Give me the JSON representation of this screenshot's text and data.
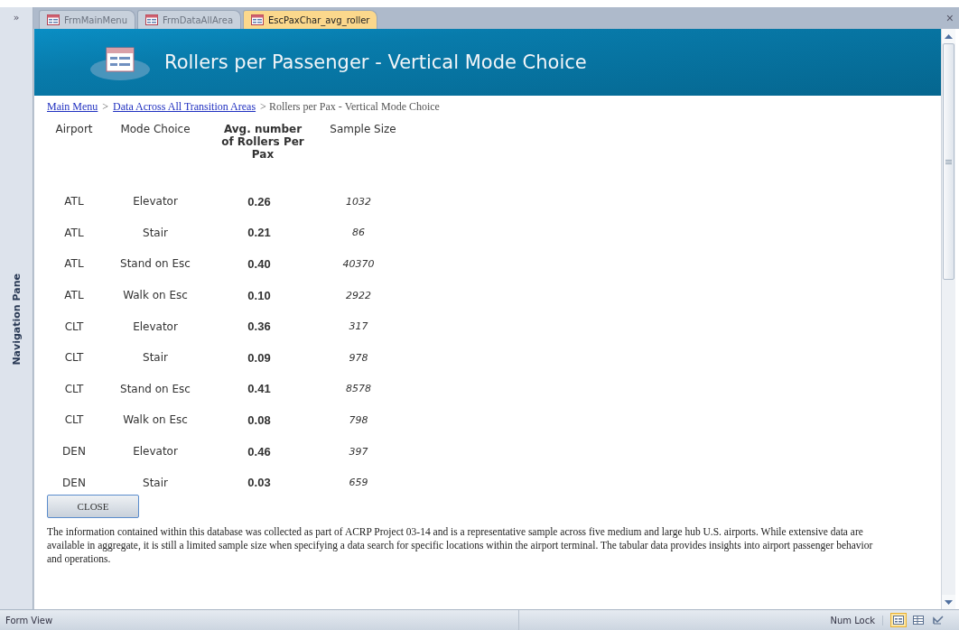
{
  "nav_toggle": "»",
  "nav_pane": {
    "label": "Navigation Pane"
  },
  "tabs": [
    {
      "label": "FrmMainMenu",
      "selected": false
    },
    {
      "label": "FrmDataAllArea",
      "selected": false
    },
    {
      "label": "EscPaxChar_avg_roller",
      "selected": true
    }
  ],
  "close_tab": "×",
  "header": {
    "title": "Rollers per Passenger - Vertical Mode Choice"
  },
  "breadcrumb": [
    {
      "label": "Main Menu",
      "kind": "link"
    },
    {
      "label": ">",
      "kind": "separator"
    },
    {
      "label": "Data Across All Transition Areas",
      "kind": "link"
    },
    {
      "label": "> Rollers per Pax - Vertical Mode Choice",
      "kind": "current"
    }
  ],
  "table": {
    "columns": [
      "Airport",
      "Mode Choice",
      "Avg. number of Rollers Per Pax",
      "Sample Size"
    ],
    "rows": [
      [
        "ATL",
        "Elevator",
        "0.26",
        "1032"
      ],
      [
        "ATL",
        "Stair",
        "0.21",
        "86"
      ],
      [
        "ATL",
        "Stand on Esc",
        "0.40",
        "40370"
      ],
      [
        "ATL",
        "Walk on Esc",
        "0.10",
        "2922"
      ],
      [
        "CLT",
        "Elevator",
        "0.36",
        "317"
      ],
      [
        "CLT",
        "Stair",
        "0.09",
        "978"
      ],
      [
        "CLT",
        "Stand on Esc",
        "0.41",
        "8578"
      ],
      [
        "CLT",
        "Walk on Esc",
        "0.08",
        "798"
      ],
      [
        "DEN",
        "Elevator",
        "0.46",
        "397"
      ],
      [
        "DEN",
        "Stair",
        "0.03",
        "659"
      ]
    ]
  },
  "close_button": "CLOSE",
  "note": "The information contained within this database was collected as part of ACRP Project 03-14 and is a representative sample across five medium and large hub U.S. airports. While extensive data are available in aggregate, it is still a limited sample size when specifying a data search for specific locations within the airport terminal. The tabular data provides insights into airport passenger behavior and operations.",
  "status_bar": {
    "mode": "Form View",
    "num_lock": "Num Lock",
    "views": [
      {
        "kind": "form",
        "selected": true
      },
      {
        "kind": "layout",
        "selected": false
      },
      {
        "kind": "design",
        "selected": false
      }
    ]
  }
}
